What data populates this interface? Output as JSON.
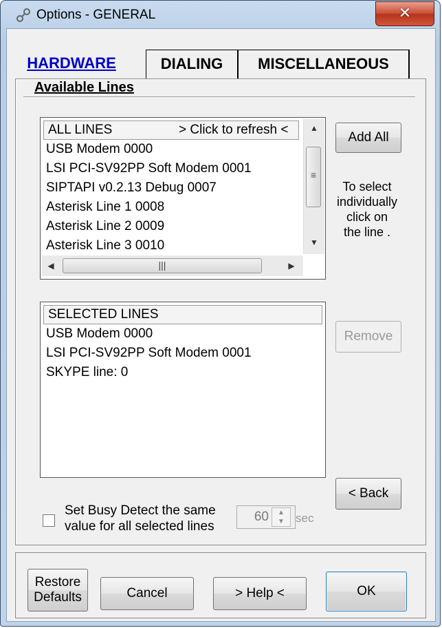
{
  "window": {
    "title": "Options - GENERAL",
    "close_label": "✕"
  },
  "tabs": [
    {
      "label": "HARDWARE",
      "active": true
    },
    {
      "label": "DIALING",
      "active": false
    },
    {
      "label": "MISCELLANEOUS",
      "active": false
    }
  ],
  "available_lines": {
    "group_title": "Available Lines",
    "all_lines_header_left": "ALL LINES",
    "all_lines_header_right": "> Click to refresh <",
    "items": [
      "USB Modem 0000",
      "LSI PCI-SV92PP Soft Modem 0001",
      "SIPTAPI v0.2.13 Debug 0007",
      "Asterisk Line 1 0008",
      "Asterisk Line 2 0009",
      "Asterisk Line 3 0010"
    ],
    "add_all_label": "Add All",
    "hint_lines": [
      "To select",
      "individually",
      "click on",
      "the line ."
    ]
  },
  "selected_lines": {
    "header": "SELECTED LINES",
    "items": [
      "USB Modem 0000",
      "LSI PCI-SV92PP Soft Modem 0001",
      "SKYPE line: 0"
    ],
    "remove_label": "Remove",
    "back_label": "< Back"
  },
  "busy_detect": {
    "line1": "Set Busy Detect the same",
    "line2": "value for all selected lines",
    "value": "60",
    "unit": "sec",
    "checked": false
  },
  "buttons": {
    "restore_line1": "Restore",
    "restore_line2": "Defaults",
    "cancel": "Cancel",
    "help": "> Help <",
    "ok": "OK"
  },
  "colors": {
    "active_tab": "#0000cc",
    "close_button": "#c94a33"
  }
}
